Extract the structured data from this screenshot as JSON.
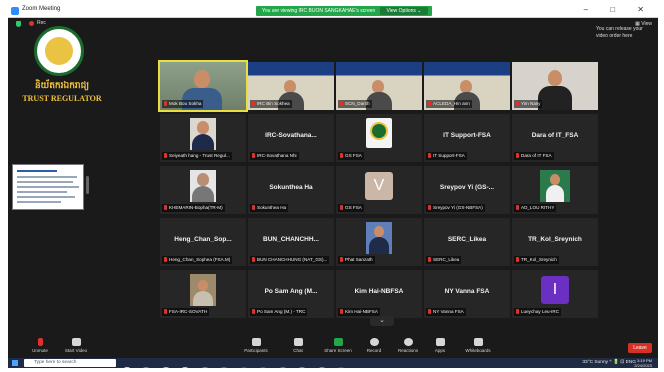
{
  "window": {
    "title": "Zoom Meeting"
  },
  "banner": {
    "text": "You are viewing IRC BUON SANGKAHAE's screen",
    "view_options": "View Options ⌄"
  },
  "window_controls": "–  □  ✕",
  "meeting": {
    "rec_label": "Rec",
    "view_label": "▦ View"
  },
  "logo": {
    "khmer_text": "និយ័តករឯករាជ្យ",
    "english_text": "TRUST REGULATOR"
  },
  "note": "You can release your video order here",
  "participants": [
    {
      "display": "",
      "label": "Mok Bou Sokha",
      "kind": "video-man",
      "active": true
    },
    {
      "display": "",
      "label": "IRC Bin Sokhea",
      "kind": "video-slide"
    },
    {
      "display": "",
      "label": "SCN_Darith",
      "kind": "video-slide"
    },
    {
      "display": "",
      "label": "ACLEDA_Hin ann",
      "kind": "video-slide"
    },
    {
      "display": "",
      "label": "Yim Nasy",
      "kind": "video-man2"
    },
    {
      "display": "",
      "label": "Seiyeath hang - Trust Regul...",
      "kind": "photo"
    },
    {
      "display": "IRC-Sovathana...",
      "label": "IRC-Sovathana Nhi",
      "kind": "name"
    },
    {
      "display": "",
      "label": "GS FSA",
      "kind": "emblem"
    },
    {
      "display": "IT Support-FSA",
      "label": "IT Support-FSA",
      "kind": "name"
    },
    {
      "display": "Dara of IT_FSA",
      "label": "Dara of IT FSA",
      "kind": "name"
    },
    {
      "display": "",
      "label": "KHEMARIN-Bopha(TR-M)",
      "kind": "photo-old"
    },
    {
      "display": "Sokunthea Ha",
      "label": "Sokunthea Ha",
      "kind": "name"
    },
    {
      "display": "V",
      "label": "GS FSA",
      "kind": "letter"
    },
    {
      "display": "Sreypov Yi (GS-...",
      "label": "Sreypov Yi (GS-NBFSA)",
      "kind": "name"
    },
    {
      "display": "",
      "label": "AD_LOU RITHY",
      "kind": "photo-green"
    },
    {
      "display": "Heng_Chan_Sop...",
      "label": "Heng_Chan_Sophea (FSA.M)",
      "kind": "name"
    },
    {
      "display": "BUN_CHANCHH...",
      "label": "BUN CHANCHHUNG (NAT_GS)...",
      "kind": "name"
    },
    {
      "display": "",
      "label": "Phat Sanzath",
      "kind": "photo-blue"
    },
    {
      "display": "SERC_Likea",
      "label": "SERC_Likea",
      "kind": "name"
    },
    {
      "display": "TR_Kol_Sreynich",
      "label": "TR_Kol_Sreynich",
      "kind": "name"
    },
    {
      "display": "",
      "label": "FSA-IRC-SOVATH",
      "kind": "photo-desk"
    },
    {
      "display": "Po Sam Ang (M...",
      "label": "Po Sam Ang (M.) - TRC",
      "kind": "name"
    },
    {
      "display": "Kim Hai-NBFSA",
      "label": "Kim Hai-NBFSA",
      "kind": "name"
    },
    {
      "display": "NY Vanna FSA",
      "label": "NY Vanna FSA",
      "kind": "name"
    },
    {
      "display": "I",
      "label": "Lueychay Leu-IRC",
      "kind": "letter-purple"
    }
  ],
  "pager": "⌄",
  "toolbar": {
    "unmute": "Unmute",
    "start_video": "Start Video",
    "participants": "Participants",
    "participants_count": "33",
    "chat": "Chat",
    "share_screen": "Share Screen",
    "record": "Record",
    "reactions": "Reactions",
    "apps": "Apps",
    "whiteboards": "Whiteboards",
    "leave": "Leave"
  },
  "taskbar": {
    "search_placeholder": "Type here to search",
    "weather": "33°C Sunny",
    "tray": "^  🔋  ⊡  ENG",
    "time": "3:19 PM",
    "date": "2/24/2023"
  }
}
